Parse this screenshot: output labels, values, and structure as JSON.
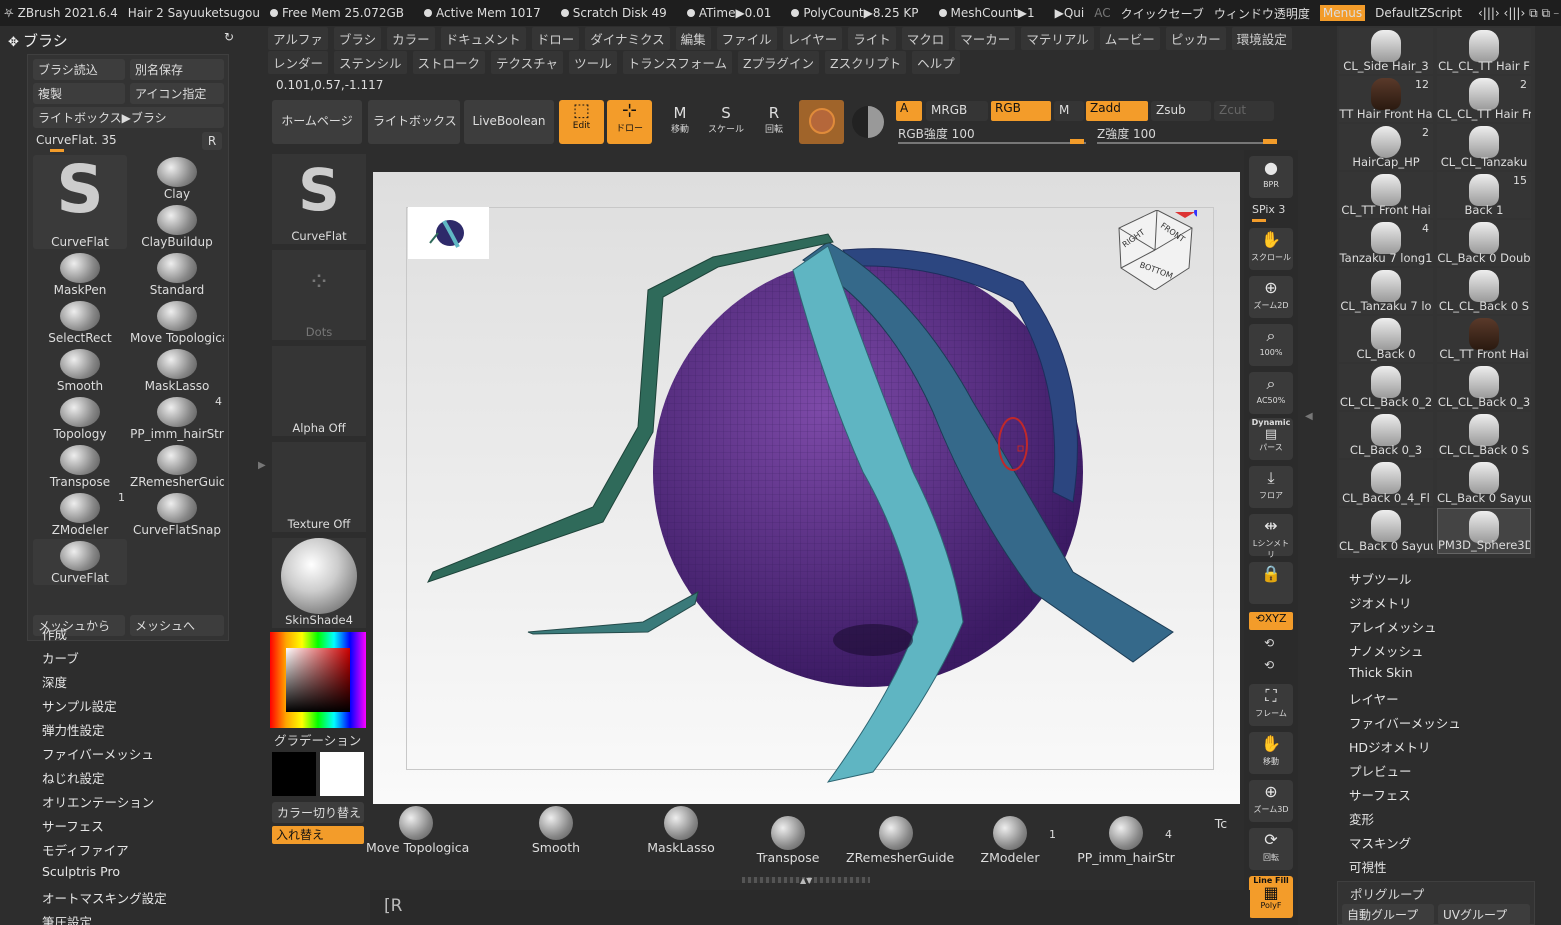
{
  "titlebar": {
    "app": "ZBrush 2021.6.4",
    "doc": "Hair 2 Sayuuketsugou",
    "free_mem": "Free Mem 25.072GB",
    "active_mem": "Active Mem 1017",
    "scratch": "Scratch Disk 49",
    "atime": "ATime▶0.01",
    "polycount": "PolyCount▶8.25 KP",
    "meshcount": "MeshCount▶1",
    "qui": "▶Qui",
    "ac": "AC",
    "quicksave": "クイックセーブ",
    "transparency": "ウィンドウ透明度",
    "menus": "Menus",
    "script": "DefaultZScript"
  },
  "menus_row1": [
    "アルファ",
    "ブラシ",
    "カラー",
    "ドキュメント",
    "ドロー",
    "ダイナミクス",
    "編集",
    "ファイル",
    "レイヤー",
    "ライト",
    "マクロ",
    "マーカー",
    "マテリアル",
    "ムービー",
    "ピッカー",
    "環境設定"
  ],
  "menus_row2": [
    "レンダー",
    "ステンシル",
    "ストローク",
    "テクスチャ",
    "ツール",
    "トランスフォーム",
    "Zプラグイン",
    "Zスクリプト",
    "ヘルプ"
  ],
  "coords": "0.101,0.57,-1.117",
  "brush_panel": {
    "title": "ブラシ",
    "load": "ブラシ読込",
    "saveas": "別名保存",
    "copy": "複製",
    "icon": "アイコン指定",
    "lightbox": "ライトボックス▶ブラシ",
    "current": "CurveFlat. 35",
    "r": "R",
    "items": [
      {
        "label": "CurveFlat",
        "badge": ""
      },
      {
        "label": "Clay",
        "badge": ""
      },
      {
        "label": "ClayBuildup",
        "badge": ""
      },
      {
        "label": "MaskPen",
        "badge": ""
      },
      {
        "label": "Standard",
        "badge": ""
      },
      {
        "label": "SelectRect",
        "badge": ""
      },
      {
        "label": "Move Topologica",
        "badge": ""
      },
      {
        "label": "Smooth",
        "badge": ""
      },
      {
        "label": "MaskLasso",
        "badge": ""
      },
      {
        "label": "Topology",
        "badge": ""
      },
      {
        "label": "PP_imm_hairStr",
        "badge": "4"
      },
      {
        "label": "Transpose",
        "badge": ""
      },
      {
        "label": "ZRemesherGuide",
        "badge": ""
      },
      {
        "label": "ZModeler",
        "badge": "1"
      },
      {
        "label": "CurveFlatSnap",
        "badge": ""
      },
      {
        "label": "CurveFlat",
        "badge": ""
      }
    ],
    "from_mesh": "メッシュから",
    "to_mesh": "メッシュへ"
  },
  "left_menu": [
    "作成",
    "カーブ",
    "深度",
    "サンプル設定",
    "弾力性設定",
    "ファイバーメッシュ",
    "ねじれ設定",
    "オリエンテーション",
    "サーフェス",
    "モディファイア",
    "Sculptris Pro",
    "オートマスキング設定",
    "筆圧設定"
  ],
  "toolbar": {
    "homepage": "ホームページ",
    "lightbox": "ライトボックス",
    "liveboolean": "LiveBoolean",
    "edit": "Edit",
    "draw": "ドロー",
    "move": "移動",
    "scale": "スケール",
    "rotate": "回転",
    "a": "A",
    "mrgb": "MRGB",
    "rgb": "RGB",
    "m": "M",
    "zadd": "Zadd",
    "zsub": "Zsub",
    "zcut": "Zcut",
    "rgb_intensity": "RGB強度 100",
    "z_intensity": "Z強度 100"
  },
  "left_column": {
    "brush": "CurveFlat",
    "stroke": "Dots",
    "alpha": "Alpha Off",
    "texture": "Texture Off",
    "material": "SkinShade4",
    "gradient": "グラデーション",
    "swap": "カラー切り替え",
    "replace": "入れ替え"
  },
  "right_shelf": {
    "bpr": "BPR",
    "spix": "SPix 3",
    "scroll": "スクロール",
    "zoom2d": "ズーム2D",
    "p100": "100%",
    "ac50": "AC50%",
    "dynamic": "Dynamic",
    "perspective": "パース",
    "floor": "フロア",
    "symmetry": "Lシンメトリ",
    "xyz": "XYZ",
    "frame": "フレーム",
    "move": "移動",
    "zoom3d": "ズーム3D",
    "rotate": "回転",
    "linefill": "Line Fill",
    "polyf": "PolyF"
  },
  "tools": [
    {
      "label": "CL_Side Hair_3",
      "badge": ""
    },
    {
      "label": "CL_CL_TT Hair F",
      "badge": ""
    },
    {
      "label": "TT Hair Front Ha",
      "badge": "12"
    },
    {
      "label": "CL_CL_TT Hair Fron",
      "badge": "2"
    },
    {
      "label": "HairCap_HP",
      "badge": "2"
    },
    {
      "label": "CL_CL_Tanzaku",
      "badge": ""
    },
    {
      "label": "CL_TT Front Hai",
      "badge": ""
    },
    {
      "label": "Back 1",
      "badge": "15"
    },
    {
      "label": "Tanzaku 7 long1",
      "badge": "4"
    },
    {
      "label": "CL_Back 0 Doub",
      "badge": ""
    },
    {
      "label": "CL_Tanzaku 7 lo",
      "badge": ""
    },
    {
      "label": "CL_CL_Back 0 S",
      "badge": ""
    },
    {
      "label": "CL_Back 0",
      "badge": ""
    },
    {
      "label": "CL_TT Front Hai",
      "badge": ""
    },
    {
      "label": "CL_CL_Back 0_2",
      "badge": ""
    },
    {
      "label": "CL_CL_Back 0_3",
      "badge": ""
    },
    {
      "label": "CL_Back 0_3",
      "badge": ""
    },
    {
      "label": "CL_CL_Back 0 S",
      "badge": ""
    },
    {
      "label": "CL_Back 0_4_Fl",
      "badge": ""
    },
    {
      "label": "CL_Back 0 Sayuu",
      "badge": ""
    },
    {
      "label": "CL_Back 0 Sayuu",
      "badge": ""
    },
    {
      "label": "PM3D_Sphere3D",
      "badge": ""
    }
  ],
  "right_menu": [
    "サブツール",
    "ジオメトリ",
    "アレイメッシュ",
    "ナノメッシュ",
    "Thick Skin",
    "レイヤー",
    "ファイバーメッシュ",
    "HDジオメトリ",
    "プレビュー",
    "サーフェス",
    "変形",
    "マスキング",
    "可視性"
  ],
  "polygroup": {
    "title": "ポリグループ",
    "auto": "自動グループ",
    "uv": "UVグループ"
  },
  "bottom_shelf": [
    {
      "label": "Move Topologica",
      "badge": ""
    },
    {
      "label": "Smooth",
      "badge": ""
    },
    {
      "label": "MaskLasso",
      "badge": ""
    },
    {
      "label": "Transpose",
      "badge": ""
    },
    {
      "label": "ZRemesherGuide",
      "badge": ""
    },
    {
      "label": "ZModeler",
      "badge": "1"
    },
    {
      "label": "PP_imm_hairStr",
      "badge": "4"
    },
    {
      "label": "Tc",
      "badge": ""
    }
  ],
  "note_text": "[R",
  "cube": {
    "right": "RIGHT",
    "front": "FRONT",
    "bottom": "BOTTOM"
  }
}
